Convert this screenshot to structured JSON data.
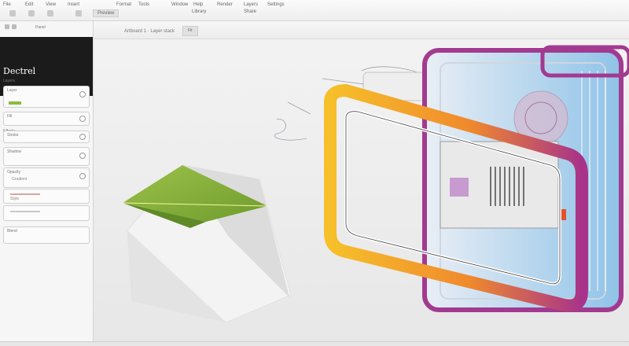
{
  "menubar": {
    "items": [
      "File",
      "Edit",
      "View",
      "Insert",
      "Format",
      "Tools",
      "Window",
      "Help",
      "Render",
      "Layers",
      "Settings",
      "Library",
      "Share"
    ],
    "button_label": "Preview"
  },
  "subbar": {
    "status": "Artboard 1  ·  Layer stack",
    "button_label": "Fit"
  },
  "sidebar": {
    "header_title": "Dectrel",
    "top_text": "Panel",
    "fields": [
      {
        "label": "Layer",
        "value": ""
      },
      {
        "label": "Fill",
        "value": ""
      },
      {
        "label": "Stroke",
        "value": ""
      },
      {
        "label": "Shadow",
        "value": ""
      },
      {
        "label": "Opacity",
        "value": ""
      },
      {
        "label": "Blend",
        "value": ""
      }
    ],
    "section_labels": [
      "Layers",
      "Effects"
    ],
    "hints": [
      "Gradient",
      "Style"
    ]
  },
  "colors": {
    "accent_green": "#8cbc3c",
    "frame_orange": "#f39a2a",
    "frame_purple": "#9a3a8c"
  },
  "icons": [
    "menu-icon",
    "settings-icon",
    "layer-icon",
    "dropdown-icon"
  ]
}
